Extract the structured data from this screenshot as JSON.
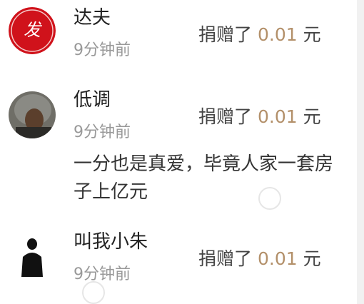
{
  "donors": [
    {
      "name": "达夫",
      "time": "9分钟前",
      "donation_prefix": "捐赠了",
      "amount": "0.01",
      "unit": "元",
      "avatar_icon": "red-seal-avatar",
      "avatar_seal_char": "发"
    },
    {
      "name": "低调",
      "time": "9分钟前",
      "donation_prefix": "捐赠了",
      "amount": "0.01",
      "unit": "元",
      "avatar_icon": "hooded-man-avatar",
      "comment": "一分也是真爱，毕竟人家一套房子上亿元"
    },
    {
      "name": "叫我小朱",
      "time": "9分钟前",
      "donation_prefix": "捐赠了",
      "amount": "0.01",
      "unit": "元",
      "avatar_icon": "silhouette-man-avatar"
    }
  ],
  "colors": {
    "amount": "#b3906a",
    "name": "#222222",
    "time": "#999999",
    "seal_red": "#d0121b"
  }
}
